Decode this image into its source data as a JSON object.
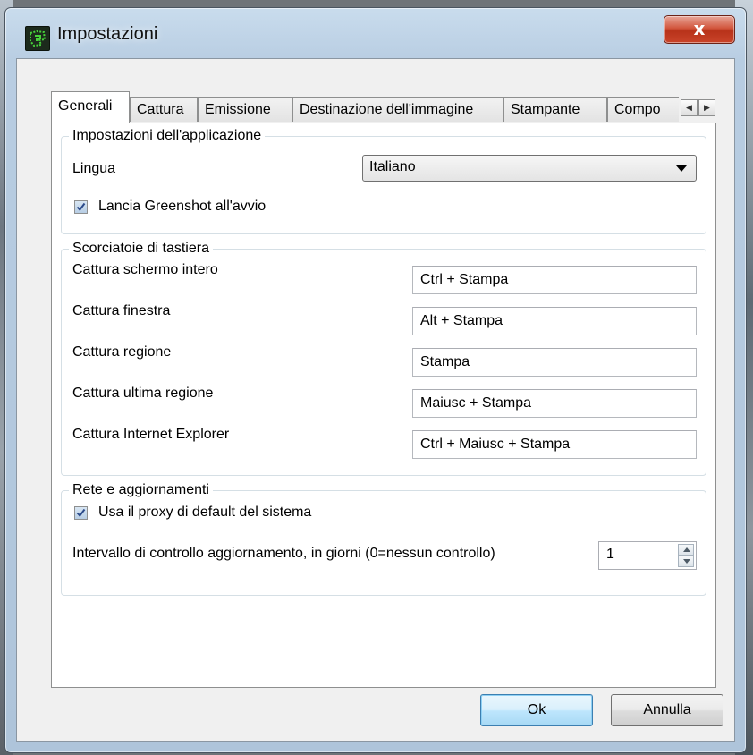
{
  "window": {
    "title": "Impostazioni",
    "close_label": "x"
  },
  "tabs": [
    {
      "label": "Generali",
      "active": true
    },
    {
      "label": "Cattura",
      "active": false
    },
    {
      "label": "Emissione",
      "active": false
    },
    {
      "label": "Destinazione dell'immagine",
      "active": false
    },
    {
      "label": "Stampante",
      "active": false
    },
    {
      "label": "Compo",
      "active": false
    }
  ],
  "tab_scroll": {
    "left": "◀",
    "right": "▶"
  },
  "app_settings": {
    "legend": "Impostazioni dell'applicazione",
    "language_label": "Lingua",
    "language_value": "Italiano",
    "autostart_label": "Lancia Greenshot all'avvio",
    "autostart_checked": true
  },
  "hotkeys": {
    "legend": "Scorciatoie di tastiera",
    "rows": [
      {
        "label": "Cattura schermo intero",
        "value": "Ctrl + Stampa"
      },
      {
        "label": "Cattura finestra",
        "value": "Alt + Stampa"
      },
      {
        "label": "Cattura regione",
        "value": "Stampa"
      },
      {
        "label": "Cattura ultima regione",
        "value": "Maiusc + Stampa"
      },
      {
        "label": "Cattura Internet Explorer",
        "value": "Ctrl + Maiusc + Stampa"
      }
    ]
  },
  "network": {
    "legend": "Rete e aggiornamenti",
    "proxy_label": "Usa il proxy di default del sistema",
    "proxy_checked": true,
    "interval_label": "Intervallo di controllo aggiornamento, in giorni (0=nessun controllo)",
    "interval_value": "1"
  },
  "buttons": {
    "ok": "Ok",
    "cancel": "Annulla"
  },
  "colors": {
    "title_bar": "#b8cde2",
    "close_button": "#c9442a",
    "default_button_border": "#3c7fb1"
  },
  "icons": {
    "app": "greenshot-icon",
    "close": "close-icon",
    "checkbox": "checkmark-icon",
    "combo": "chevron-down-icon"
  }
}
